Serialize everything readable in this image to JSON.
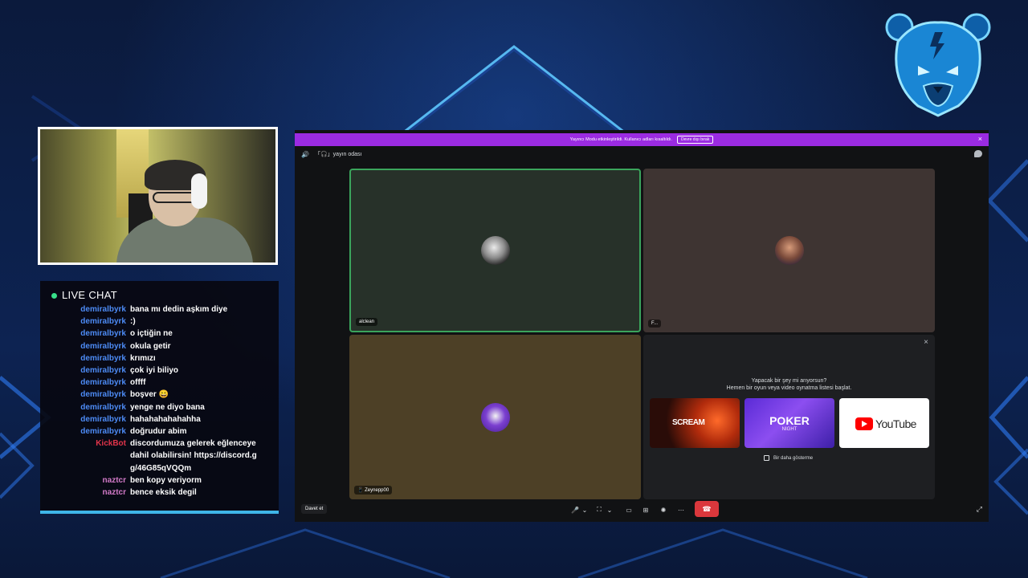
{
  "chat": {
    "header": {
      "live": "LIVE",
      "title": "CHAT"
    },
    "messages": [
      {
        "user": "demiralbyrk",
        "text": "bana mı dedin aşkım diye",
        "type": "normal"
      },
      {
        "user": "demiralbyrk",
        "text": ":)",
        "type": "normal"
      },
      {
        "user": "demiralbyrk",
        "text": "o içtiğin ne",
        "type": "normal"
      },
      {
        "user": "demiralbyrk",
        "text": "okula getir",
        "type": "normal"
      },
      {
        "user": "demiralbyrk",
        "text": "krımızı",
        "type": "normal"
      },
      {
        "user": "demiralbyrk",
        "text": "çok iyi biliyo",
        "type": "normal"
      },
      {
        "user": "demiralbyrk",
        "text": "offff",
        "type": "normal"
      },
      {
        "user": "demiralbyrk",
        "text": "boşver 😀",
        "type": "normal"
      },
      {
        "user": "demiralbyrk",
        "text": "yenge ne diyo bana",
        "type": "normal"
      },
      {
        "user": "demiralbyrk",
        "text": "hahahahahahahha",
        "type": "normal"
      },
      {
        "user": "demiralbyrk",
        "text": "doğrudur abim",
        "type": "normal"
      },
      {
        "user": "KickBot",
        "text": "discordumuza gelerek eğlenceye dahil olabilirsin! https://discord.gg/46G85qVQQm",
        "type": "bot"
      },
      {
        "user": "naztcr",
        "text": "ben kopy veriyorm",
        "type": "nz"
      },
      {
        "user": "naztcr",
        "text": "bence eksik degil",
        "type": "nz"
      }
    ]
  },
  "discord": {
    "banner": {
      "text": "Yayıncı Modu etkinleştirildi. Kullanıcı adları kısaltıldı.",
      "button": "Devre dışı bırak",
      "close": "×"
    },
    "topbar": {
      "channel": "「🎧」yayın odası",
      "icon": "speaker-icon"
    },
    "tiles": [
      {
        "name": "alclean"
      },
      {
        "name": "F..."
      },
      {
        "name": "📱 Zeynepp00"
      }
    ],
    "activity": {
      "close": "×",
      "line1": "Yapacak bir şey mi arıyorsun?",
      "line2": "Hemen bir oyun veya video oynatma listesi başlat.",
      "cards": [
        {
          "label": "SCREAM",
          "sub": ""
        },
        {
          "label": "POKER",
          "sub": "NIGHT"
        },
        {
          "label": "YouTube",
          "sub": ""
        }
      ],
      "dont_show": "Bir daha gösterme"
    },
    "bottombar": {
      "invite": "Davet et",
      "controls": [
        "🎤",
        "⌄",
        "⛶",
        "⌄",
        "▭",
        "⊞",
        "✺",
        "⋯"
      ],
      "hangup": "☎",
      "fullscreen": "⤢"
    }
  },
  "colors": {
    "accent": "#9b2be2",
    "speaking": "#3ba55c",
    "hangup": "#da373c",
    "chat_user": "#4d8bf5",
    "bot": "#e0344a"
  }
}
